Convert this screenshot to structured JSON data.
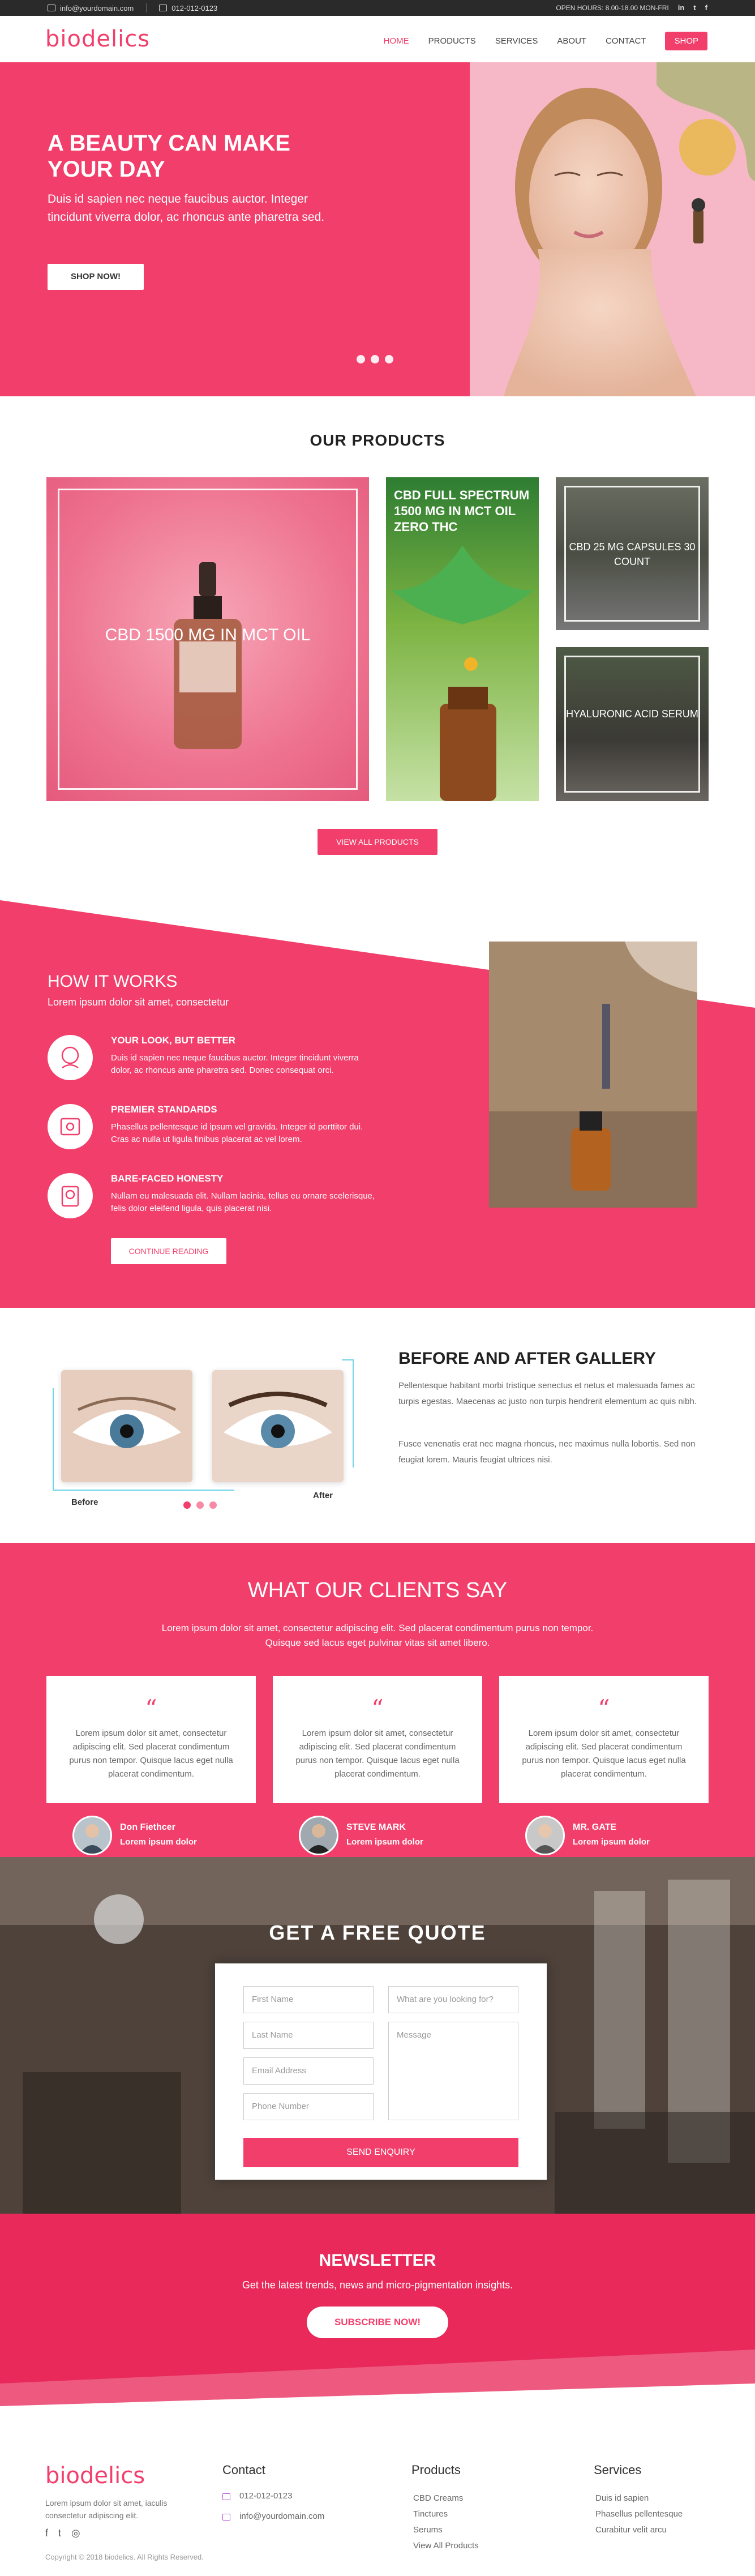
{
  "topbar": {
    "email": "info@yourdomain.com",
    "phone": "012-012-0123",
    "hours": "OPEN HOURS: 8.00-18.00 MON-FRI",
    "social": [
      "in",
      "t",
      "f"
    ]
  },
  "header": {
    "logo": "biodelics",
    "nav": [
      "HOME",
      "PRODUCTS",
      "SERVICES",
      "ABOUT",
      "CONTACT"
    ],
    "shop": "SHOP"
  },
  "hero": {
    "title": "A BEAUTY CAN MAKE YOUR DAY",
    "text": "Duis id sapien nec neque faucibus auctor. Integer tincidunt viverra dolor, ac rhoncus ante pharetra sed.",
    "button": "SHOP NOW!"
  },
  "products": {
    "title": "OUR PRODUCTS",
    "items": [
      "CBD 1500 MG IN MCT OIL",
      "CBD FULL SPECTRUM 1500 MG IN MCT OIL ZERO THC",
      "CBD 25 MG CAPSULES 30 COUNT",
      "HYALURONIC ACID SERUM"
    ],
    "button": "VIEW ALL PRODUCTS"
  },
  "how": {
    "title": "HOW IT WORKS",
    "subtitle": "Lorem ipsum dolor sit amet, consectetur",
    "features": [
      {
        "title": "YOUR LOOK, BUT BETTER",
        "text": "Duis id sapien nec neque faucibus auctor. Integer tincidunt viverra dolor, ac rhoncus ante pharetra sed. Donec consequat orci."
      },
      {
        "title": "PREMIER STANDARDS",
        "text": "Phasellus pellentesque id ipsum vel gravida. Integer id porttitor dui. Cras ac nulla ut ligula finibus placerat ac vel lorem."
      },
      {
        "title": "BARE-FACED HONESTY",
        "text": "Nullam eu malesuada elit. Nullam lacinia, tellus eu ornare scelerisque, felis dolor eleifend ligula, quis placerat nisi."
      }
    ],
    "button": "CONTINUE READING"
  },
  "gallery": {
    "title": "BEFORE AND AFTER GALLERY",
    "p1": "Pellentesque habitant morbi tristique senectus et netus et malesuada fames ac turpis egestas. Maecenas ac justo non turpis hendrerit elementum ac quis nibh.",
    "p2": "Fusce venenatis erat nec magna rhoncus, nec maximus nulla lobortis. Sed non feugiat lorem. Mauris feugiat ultrices nisi.",
    "before": "Before",
    "after": "After"
  },
  "clients": {
    "title": "WHAT OUR CLIENTS SAY",
    "subtitle": "Lorem ipsum dolor sit amet, consectetur adipiscing elit. Sed placerat condimentum purus non tempor. Quisque sed lacus eget  pulvinar vitas sit amet libero.",
    "quote_mark": "“",
    "cards": [
      {
        "text": "Lorem ipsum dolor sit amet, consectetur adipiscing elit. Sed placerat condimentum purus non tempor. Quisque lacus eget nulla placerat condimentum.",
        "name": "Don Fiethcer",
        "role": "Lorem ipsum dolor"
      },
      {
        "text": "Lorem ipsum dolor sit amet, consectetur adipiscing elit. Sed placerat condimentum purus non tempor. Quisque lacus eget nulla placerat condimentum.",
        "name": "STEVE MARK",
        "role": "Lorem ipsum dolor"
      },
      {
        "text": "Lorem ipsum dolor sit amet, consectetur adipiscing elit. Sed placerat condimentum purus non tempor. Quisque lacus eget nulla placerat condimentum.",
        "name": "MR. GATE",
        "role": "Lorem ipsum dolor"
      }
    ]
  },
  "quote": {
    "title": "GET A FREE QUOTE",
    "first_name": "First Name",
    "last_name": "Last Name",
    "email": "Email Address",
    "phone": "Phone Number",
    "looking": "What are you looking for?",
    "message": "Message",
    "submit": "SEND ENQUIRY"
  },
  "newsletter": {
    "title": "NEWSLETTER",
    "text": "Get the latest trends, news and micro-pigmentation insights.",
    "button": "SUBSCRIBE NOW!"
  },
  "footer": {
    "logo": "biodelics",
    "tagline": "Lorem ipsum dolor sit amet, iaculis consectetur adipiscing elit.",
    "copyright": "Copyright © 2018 biodelics. All Rights Reserved.",
    "contact_title": "Contact",
    "contact_phone": "012-012-0123",
    "contact_email": "info@yourdomain.com",
    "products_title": "Products",
    "products": [
      "CBD Creams",
      "Tinctures",
      "Serums",
      "View All Products"
    ],
    "services_title": "Services",
    "services": [
      "Duis id sapien",
      "Phasellus pellentesque",
      "Curabitur velit arcu"
    ]
  },
  "colors": {
    "accent": "#f23e6b",
    "dark": "#2a2a2a"
  }
}
